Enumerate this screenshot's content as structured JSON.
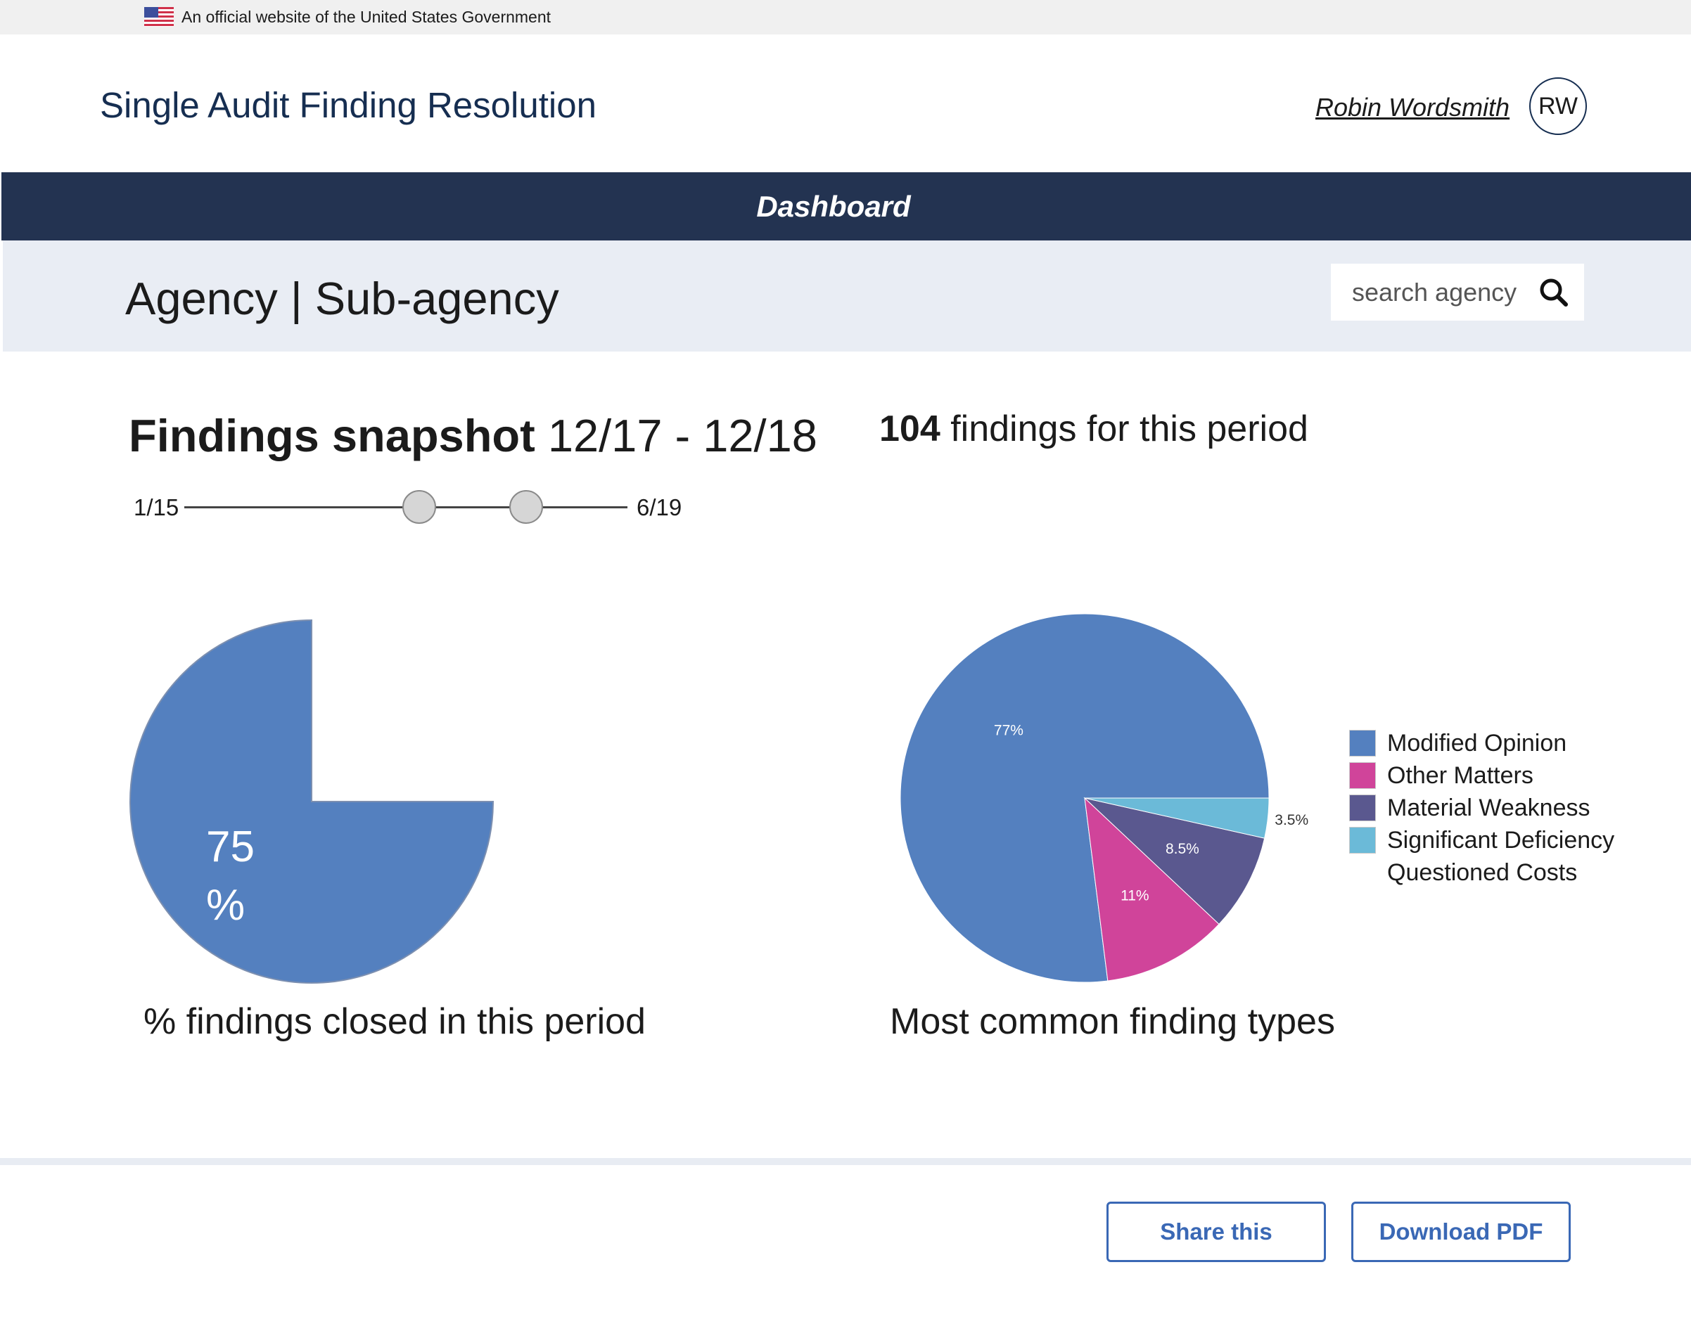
{
  "gov_banner": {
    "text": "An official website of the United States Government"
  },
  "header": {
    "app_title": "Single Audit Finding Resolution",
    "user_name": "Robin  Wordsmith",
    "user_initials": "RW"
  },
  "nav": {
    "active_label": "Dashboard"
  },
  "agency": {
    "title": "Agency | Sub-agency",
    "search_placeholder": "search agency"
  },
  "snapshot": {
    "title_bold": "Findings snapshot",
    "period": "12/17 - 12/18",
    "slider": {
      "start_label": "1/15",
      "end_label": "6/19"
    },
    "findings_count": "104",
    "findings_count_suffix": " findings for this period"
  },
  "colors": {
    "modified_opinion": "#5480bf",
    "other_matters": "#d0449a",
    "material_weakness": "#5a588f",
    "significant_deficiency": "#6bbad8",
    "nav_bg": "#233351",
    "accent": "#3a68b5"
  },
  "chart_data": [
    {
      "type": "pie",
      "values": [
        75,
        25
      ],
      "value_label": "75",
      "unit_label": "%",
      "caption": "% findings closed in this period"
    },
    {
      "type": "pie",
      "caption": "Most common finding types",
      "slices": [
        {
          "name": "Modified Opinion",
          "value": 77,
          "label": "77%",
          "color": "#5480bf"
        },
        {
          "name": "Other Matters",
          "value": 11,
          "label": "11%",
          "color": "#d0449a"
        },
        {
          "name": "Material Weakness",
          "value": 8.5,
          "label": "8.5%",
          "color": "#5a588f"
        },
        {
          "name": "Significant Deficiency",
          "value": 3.5,
          "label": "3.5%",
          "color": "#6bbad8"
        }
      ],
      "legend": [
        "Modified Opinion",
        "Other Matters",
        "Material Weakness",
        "Significant Deficiency",
        "Questioned Costs"
      ],
      "legend_placement": "right"
    }
  ],
  "footer": {
    "share_label": "Share this",
    "download_label": "Download PDF"
  }
}
